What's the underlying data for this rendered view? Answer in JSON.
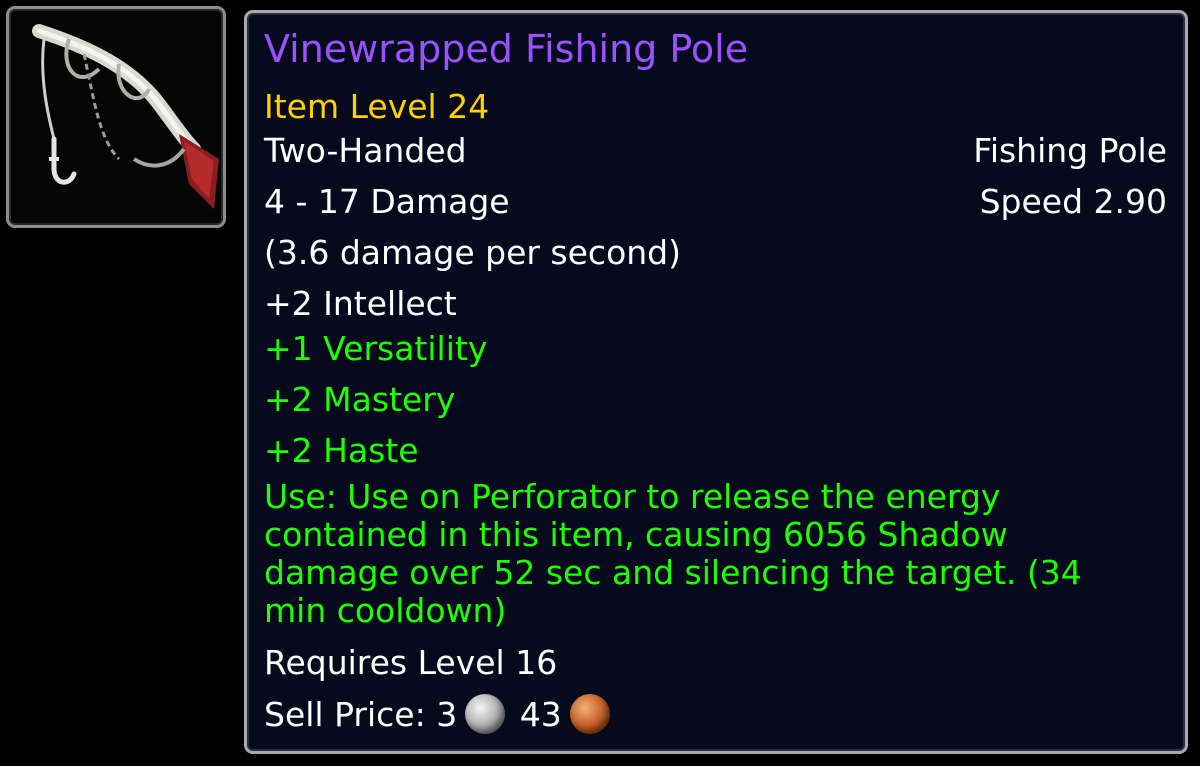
{
  "item": {
    "name": "Vinewrapped Fishing Pole",
    "item_level": "Item Level 24",
    "slot": "Two-Handed",
    "weapon_type": "Fishing Pole",
    "damage": "4 - 17 Damage",
    "speed": "Speed 2.90",
    "dps": "(3.6 damage per second)",
    "stats": {
      "intellect": "+2 Intellect",
      "versatility": "+1 Versatility",
      "mastery": "+2 Mastery",
      "haste": "+2 Haste"
    },
    "use_line1": "Use: Use on Perforator to release the energy",
    "use_line2": "contained in this item, causing 6056 Shadow",
    "use_line3": "damage over 52 sec and silencing the target. (34",
    "use_line4": "min cooldown)",
    "requires": "Requires Level 16",
    "sell_label": "Sell Price:",
    "sell_silver": "3",
    "sell_copper": "43"
  },
  "icon": {
    "name": "fishing-pole-icon"
  },
  "colors": {
    "title": "#9a52ff",
    "item_level": "#ffd100",
    "green_text": "#1eff00",
    "white_text": "#ffffff",
    "tooltip_bg": "#070a1d",
    "border": "#a9a9a9"
  }
}
